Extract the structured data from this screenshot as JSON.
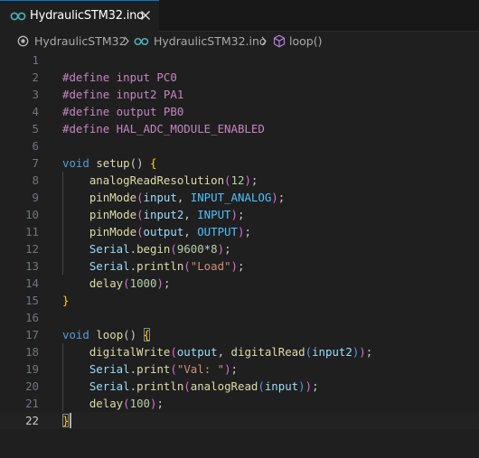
{
  "tab": {
    "label": "HydraulicSTM32.ino"
  },
  "breadcrumb": {
    "folder": "HydraulicSTM32",
    "file": "HydraulicSTM32.ino",
    "symbol": "loop()"
  },
  "colors": {
    "accent": "#0078d4",
    "background": "#1f1f1f"
  },
  "editor": {
    "current_line": "22",
    "line_numbers": [
      "1",
      "2",
      "3",
      "4",
      "5",
      "6",
      "7",
      "8",
      "9",
      "10",
      "11",
      "12",
      "13",
      "14",
      "15",
      "16",
      "17",
      "18",
      "19",
      "20",
      "21",
      "22"
    ],
    "lines": [
      [],
      [
        {
          "t": "#define input PC0",
          "c": "dir"
        }
      ],
      [
        {
          "t": "#define input2 PA1",
          "c": "dir"
        }
      ],
      [
        {
          "t": "#define output PB0",
          "c": "dir"
        }
      ],
      [
        {
          "t": "#define HAL_ADC_MODULE_ENABLED",
          "c": "dir"
        }
      ],
      [],
      [
        {
          "t": "void ",
          "c": "kw"
        },
        {
          "t": "setup",
          "c": "fn"
        },
        {
          "t": "() ",
          "c": ""
        },
        {
          "t": "{",
          "c": "br1"
        }
      ],
      [
        {
          "t": "    ",
          "c": ""
        },
        {
          "t": "analogReadResolution",
          "c": "fn"
        },
        {
          "t": "(",
          "c": "br2"
        },
        {
          "t": "12",
          "c": "num"
        },
        {
          "t": ")",
          "c": "br2"
        },
        {
          "t": ";",
          "c": ""
        }
      ],
      [
        {
          "t": "    ",
          "c": ""
        },
        {
          "t": "pinMode",
          "c": "fn"
        },
        {
          "t": "(",
          "c": "br2"
        },
        {
          "t": "input",
          "c": "var"
        },
        {
          "t": ", ",
          "c": ""
        },
        {
          "t": "INPUT_ANALOG",
          "c": "cst"
        },
        {
          "t": ")",
          "c": "br2"
        },
        {
          "t": ";",
          "c": ""
        }
      ],
      [
        {
          "t": "    ",
          "c": ""
        },
        {
          "t": "pinMode",
          "c": "fn"
        },
        {
          "t": "(",
          "c": "br2"
        },
        {
          "t": "input2",
          "c": "var"
        },
        {
          "t": ", ",
          "c": ""
        },
        {
          "t": "INPUT",
          "c": "cst"
        },
        {
          "t": ")",
          "c": "br2"
        },
        {
          "t": ";",
          "c": ""
        }
      ],
      [
        {
          "t": "    ",
          "c": ""
        },
        {
          "t": "pinMode",
          "c": "fn"
        },
        {
          "t": "(",
          "c": "br2"
        },
        {
          "t": "output",
          "c": "var"
        },
        {
          "t": ", ",
          "c": ""
        },
        {
          "t": "OUTPUT",
          "c": "cst"
        },
        {
          "t": ")",
          "c": "br2"
        },
        {
          "t": ";",
          "c": ""
        }
      ],
      [
        {
          "t": "    ",
          "c": ""
        },
        {
          "t": "Serial",
          "c": "var"
        },
        {
          "t": ".",
          "c": ""
        },
        {
          "t": "begin",
          "c": "fn"
        },
        {
          "t": "(",
          "c": "br2"
        },
        {
          "t": "9600",
          "c": "num"
        },
        {
          "t": "*",
          "c": ""
        },
        {
          "t": "8",
          "c": "num"
        },
        {
          "t": ")",
          "c": "br2"
        },
        {
          "t": ";",
          "c": ""
        }
      ],
      [
        {
          "t": "    ",
          "c": ""
        },
        {
          "t": "Serial",
          "c": "var"
        },
        {
          "t": ".",
          "c": ""
        },
        {
          "t": "println",
          "c": "fn"
        },
        {
          "t": "(",
          "c": "br2"
        },
        {
          "t": "\"Load\"",
          "c": "str"
        },
        {
          "t": ")",
          "c": "br2"
        },
        {
          "t": ";",
          "c": ""
        }
      ],
      [
        {
          "t": "    ",
          "c": ""
        },
        {
          "t": "delay",
          "c": "fn"
        },
        {
          "t": "(",
          "c": "br2"
        },
        {
          "t": "1000",
          "c": "num"
        },
        {
          "t": ")",
          "c": "br2"
        },
        {
          "t": ";",
          "c": ""
        }
      ],
      [
        {
          "t": "}",
          "c": "br1"
        }
      ],
      [],
      [
        {
          "t": "void ",
          "c": "kw"
        },
        {
          "t": "loop",
          "c": "fn"
        },
        {
          "t": "() ",
          "c": ""
        },
        {
          "t": "{",
          "c": "br1 matched"
        }
      ],
      [
        {
          "t": "    ",
          "c": ""
        },
        {
          "t": "digitalWrite",
          "c": "fn"
        },
        {
          "t": "(",
          "c": "br2"
        },
        {
          "t": "output",
          "c": "var"
        },
        {
          "t": ", ",
          "c": ""
        },
        {
          "t": "digitalRead",
          "c": "fn"
        },
        {
          "t": "(",
          "c": "kw"
        },
        {
          "t": "input2",
          "c": "var"
        },
        {
          "t": ")",
          "c": "kw"
        },
        {
          "t": ")",
          "c": "br2"
        },
        {
          "t": ";",
          "c": ""
        }
      ],
      [
        {
          "t": "    ",
          "c": ""
        },
        {
          "t": "Serial",
          "c": "var"
        },
        {
          "t": ".",
          "c": ""
        },
        {
          "t": "print",
          "c": "fn"
        },
        {
          "t": "(",
          "c": "br2"
        },
        {
          "t": "\"Val: \"",
          "c": "str"
        },
        {
          "t": ")",
          "c": "br2"
        },
        {
          "t": ";",
          "c": ""
        }
      ],
      [
        {
          "t": "    ",
          "c": ""
        },
        {
          "t": "Serial",
          "c": "var"
        },
        {
          "t": ".",
          "c": ""
        },
        {
          "t": "println",
          "c": "fn"
        },
        {
          "t": "(",
          "c": "br2"
        },
        {
          "t": "analogRead",
          "c": "fn"
        },
        {
          "t": "(",
          "c": "kw"
        },
        {
          "t": "input",
          "c": "var"
        },
        {
          "t": ")",
          "c": "kw"
        },
        {
          "t": ")",
          "c": "br2"
        },
        {
          "t": ";",
          "c": ""
        }
      ],
      [
        {
          "t": "    ",
          "c": ""
        },
        {
          "t": "delay",
          "c": "fn"
        },
        {
          "t": "(",
          "c": "br2"
        },
        {
          "t": "100",
          "c": "num"
        },
        {
          "t": ")",
          "c": "br2"
        },
        {
          "t": ";",
          "c": ""
        }
      ],
      [
        {
          "t": "}",
          "c": "br1 matched"
        }
      ]
    ]
  }
}
